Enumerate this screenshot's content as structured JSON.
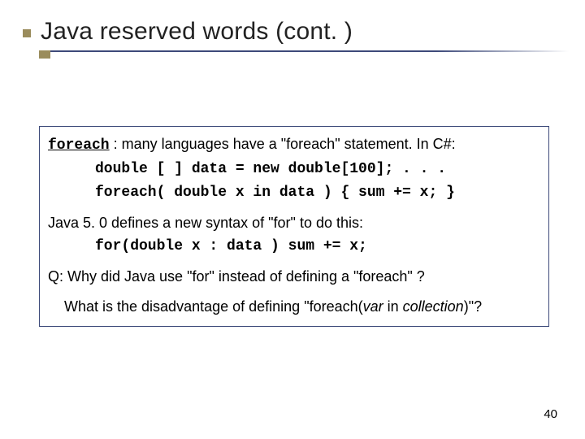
{
  "title": "Java reserved words (cont. )",
  "box": {
    "line1_keyword": "foreach",
    "line1_rest": " : many languages have a \"foreach\" statement.  In C#:",
    "code1": "double [ ] data = new double[100];  . . .",
    "code2": "foreach( double x in data ) { sum += x; }",
    "line4": "Java 5. 0 defines a new syntax of \"for\" to do this:",
    "code3": "for(double x : data ) sum += x;",
    "q1": "Q: Why did Java use \"for\" instead of defining a \"foreach\" ?",
    "q2_pre": "What is the disadvantage of defining \"foreach(",
    "q2_var": "var",
    "q2_in": " in ",
    "q2_col": "collection",
    "q2_post": ")\"?"
  },
  "page": "40"
}
